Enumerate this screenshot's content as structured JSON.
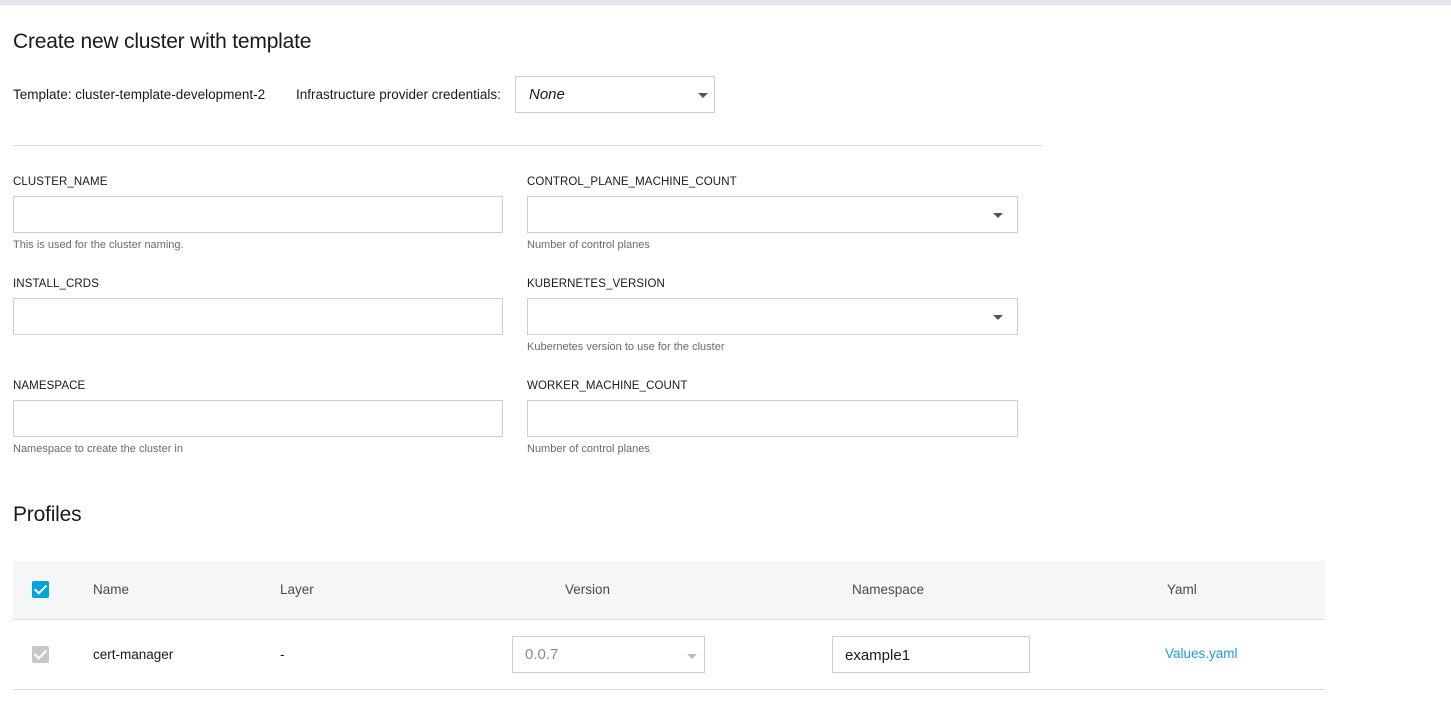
{
  "page": {
    "title": "Create new cluster with template",
    "template_label": "Template: cluster-template-development-2",
    "credentials_label": "Infrastructure provider credentials:",
    "credentials_value": "None"
  },
  "form": {
    "cluster_name": {
      "label": "CLUSTER_NAME",
      "value": "",
      "helper": "This is used for the cluster naming."
    },
    "control_plane_machine_count": {
      "label": "CONTROL_PLANE_MACHINE_COUNT",
      "value": "",
      "helper": "Number of control planes"
    },
    "install_crds": {
      "label": "INSTALL_CRDS",
      "value": "",
      "helper": ""
    },
    "kubernetes_version": {
      "label": "KUBERNETES_VERSION",
      "value": "",
      "helper": "Kubernetes version to use for the cluster"
    },
    "namespace": {
      "label": "NAMESPACE",
      "value": "",
      "helper": "Namespace to create the cluster in"
    },
    "worker_machine_count": {
      "label": "WORKER_MACHINE_COUNT",
      "value": "",
      "helper": "Number of control planes"
    }
  },
  "profiles": {
    "title": "Profiles",
    "columns": [
      "Name",
      "Layer",
      "Version",
      "Namespace",
      "Yaml"
    ],
    "rows": [
      {
        "name": "cert-manager",
        "layer": "-",
        "version": "0.0.7",
        "namespace": "example1",
        "yaml": "Values.yaml",
        "checked": true
      }
    ]
  },
  "colors": {
    "accent": "#00a3e0",
    "link": "#1e9bd7",
    "border": "#cfcfcf"
  }
}
